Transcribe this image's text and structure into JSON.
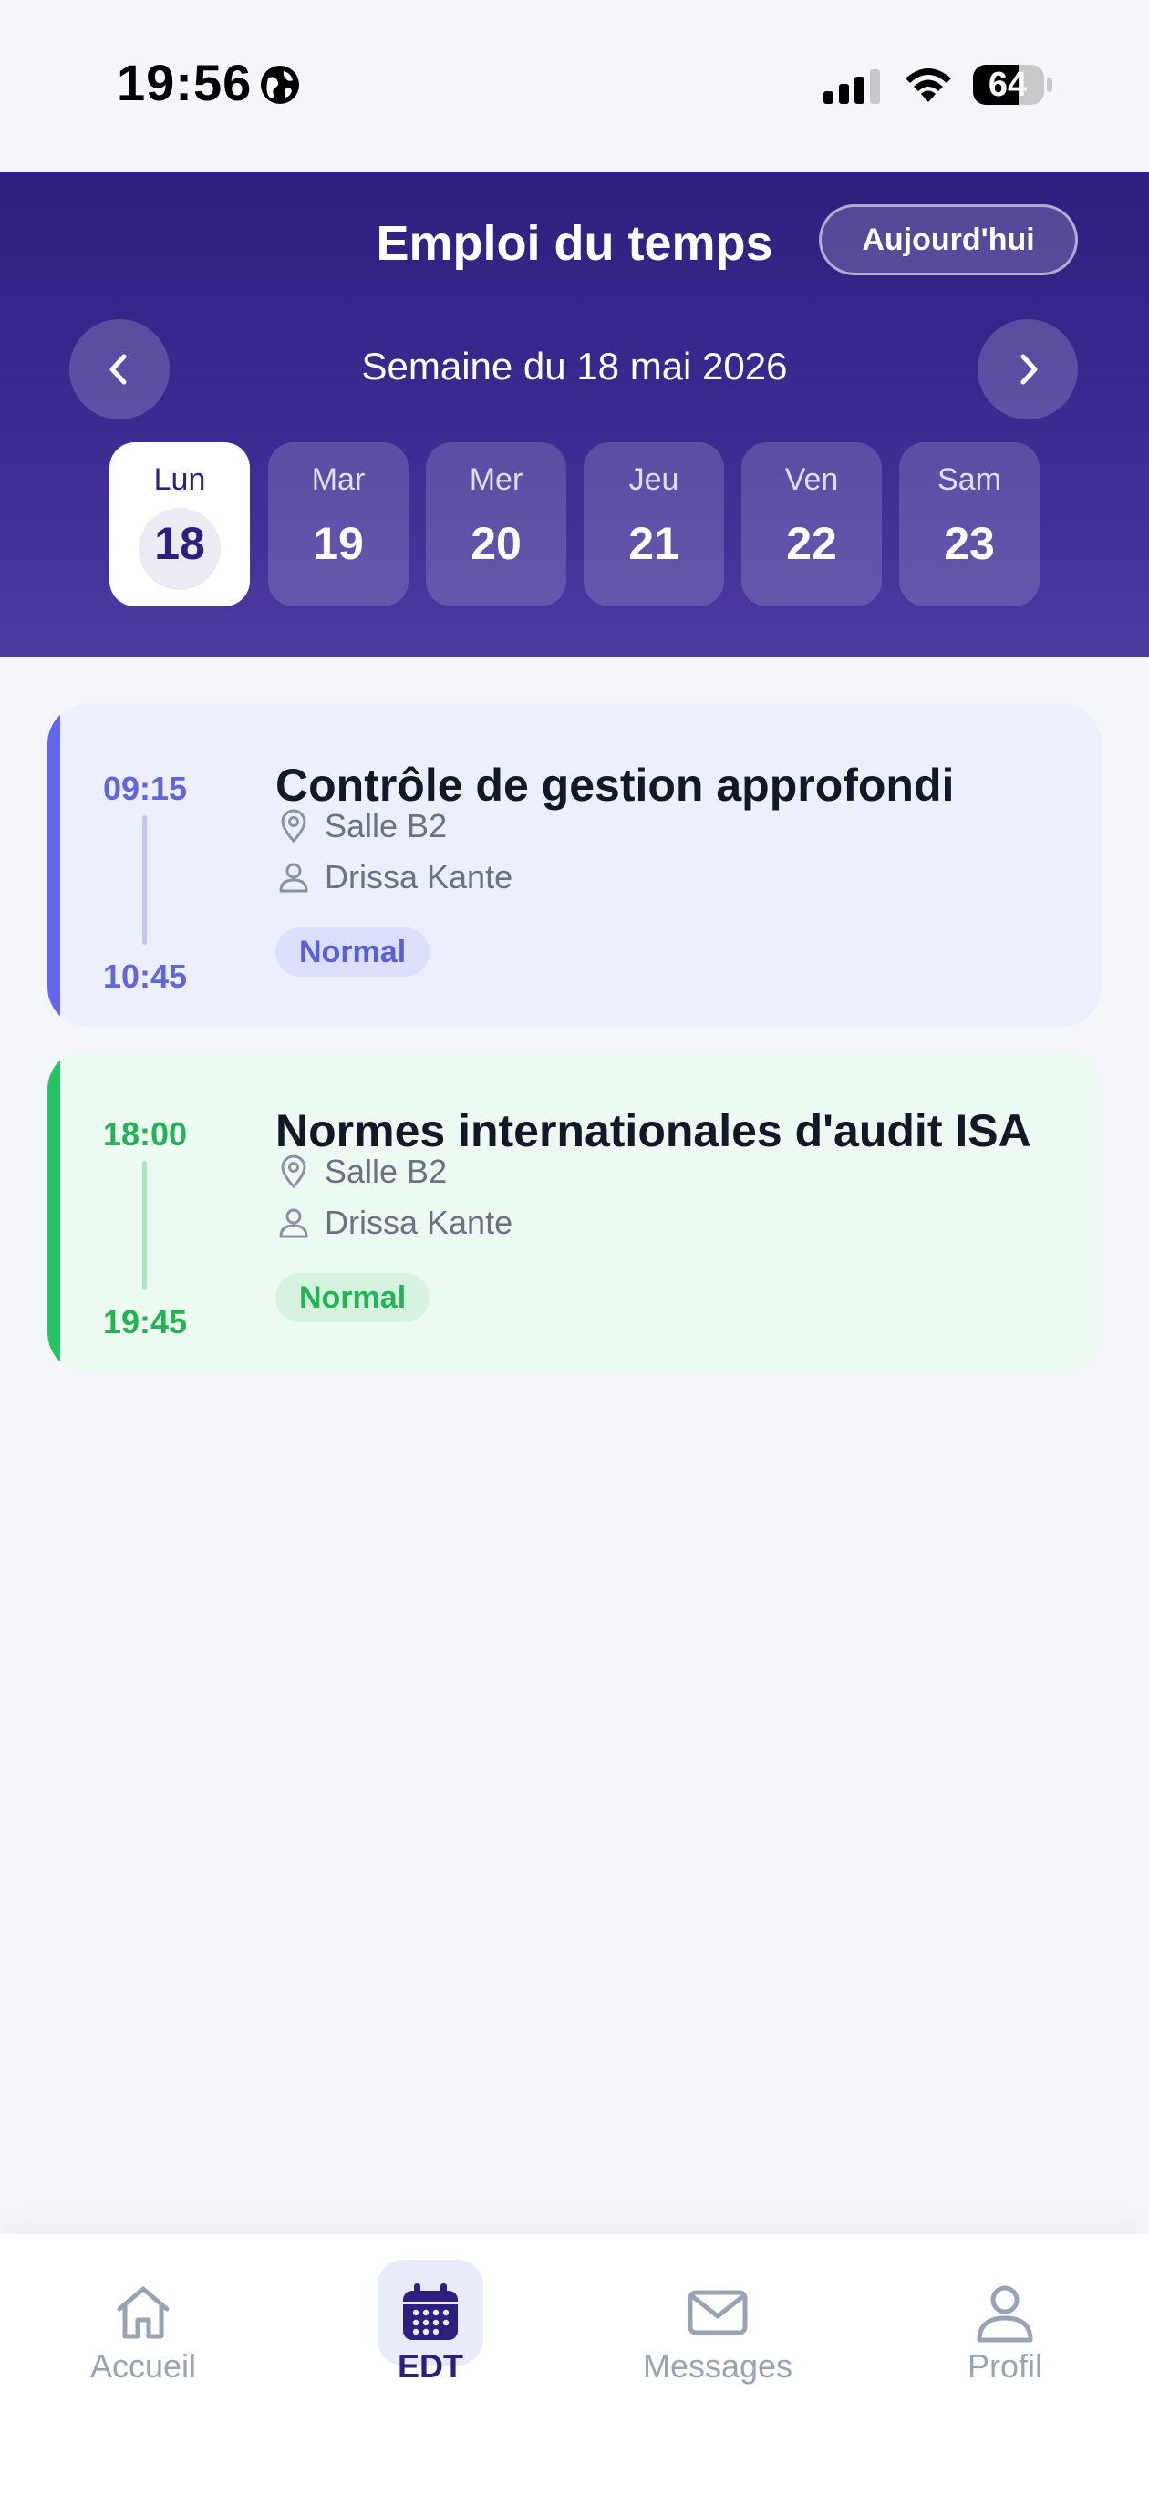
{
  "status_bar": {
    "time": "19:56",
    "battery": "64"
  },
  "header": {
    "title": "Emploi du temps",
    "today_button": "Aujourd'hui",
    "week_label": "Semaine du 18 mai 2026"
  },
  "days": [
    {
      "name": "Lun",
      "number": "18",
      "selected": true
    },
    {
      "name": "Mar",
      "number": "19"
    },
    {
      "name": "Mer",
      "number": "20"
    },
    {
      "name": "Jeu",
      "number": "21"
    },
    {
      "name": "Ven",
      "number": "22"
    },
    {
      "name": "Sam",
      "number": "23"
    }
  ],
  "courses": [
    {
      "start": "09:15",
      "end": "10:45",
      "title": "Contrôle de gestion approfondi",
      "room": "Salle B2",
      "teacher": "Drissa Kante",
      "badge": "Normal",
      "accent_color": "#6366f1"
    },
    {
      "start": "18:00",
      "end": "19:45",
      "title": "Normes internationales d'audit ISA",
      "room": "Salle B2",
      "teacher": "Drissa Kante",
      "badge": "Normal",
      "accent_color": "#22c55e"
    }
  ],
  "tab_bar": {
    "items": [
      {
        "label": "Accueil",
        "icon": "home-icon"
      },
      {
        "label": "EDT",
        "icon": "calendar-icon",
        "active": true
      },
      {
        "label": "Messages",
        "icon": "mail-icon"
      },
      {
        "label": "Profil",
        "icon": "user-icon"
      }
    ]
  },
  "colors": {
    "header_gradient_start": "#2d1f7e",
    "header_gradient_end": "#4b3aa0",
    "active_tab": "#2d1f7e"
  }
}
